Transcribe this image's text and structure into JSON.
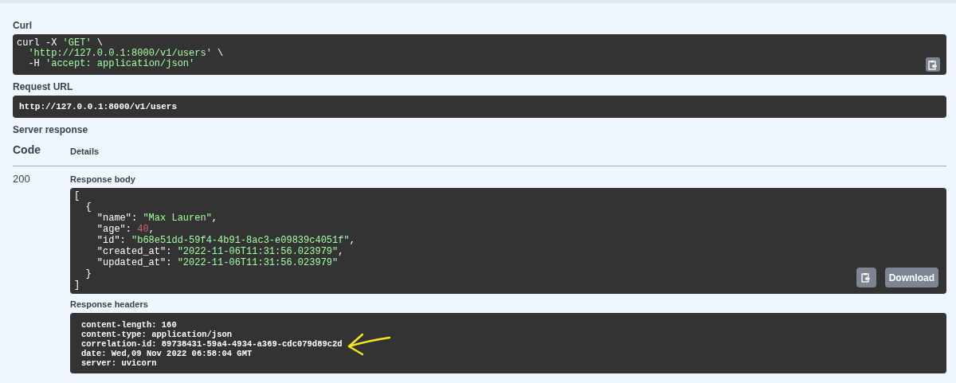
{
  "curl": {
    "label": "Curl",
    "lines": [
      [
        {
          "kind": "plain",
          "text": "curl -X "
        },
        {
          "kind": "string",
          "text": "'GET'"
        },
        {
          "kind": "plain",
          "text": " \\"
        }
      ],
      [
        {
          "kind": "string",
          "text": "  'http://127.0.0.1:8000/v1/users'"
        },
        {
          "kind": "plain",
          "text": " \\"
        }
      ],
      [
        {
          "kind": "plain",
          "text": "  -H "
        },
        {
          "kind": "string",
          "text": "'accept: application/json'"
        }
      ]
    ]
  },
  "request_url": {
    "label": "Request URL",
    "value": "http://127.0.0.1:8000/v1/users"
  },
  "server_response": {
    "label": "Server response",
    "columns": [
      "Code",
      "Details"
    ],
    "code": "200",
    "body": {
      "label": "Response body",
      "download": "Download",
      "lines": [
        [
          {
            "kind": "plain",
            "text": "["
          }
        ],
        [
          {
            "kind": "plain",
            "text": "  {"
          }
        ],
        [
          {
            "kind": "plain",
            "text": "    \"name\": "
          },
          {
            "kind": "string",
            "text": "\"Max Lauren\""
          },
          {
            "kind": "plain",
            "text": ","
          }
        ],
        [
          {
            "kind": "plain",
            "text": "    \"age\": "
          },
          {
            "kind": "number",
            "text": "40"
          },
          {
            "kind": "plain",
            "text": ","
          }
        ],
        [
          {
            "kind": "plain",
            "text": "    \"id\": "
          },
          {
            "kind": "string",
            "text": "\"b68e51dd-59f4-4b91-8ac3-e09839c4051f\""
          },
          {
            "kind": "plain",
            "text": ","
          }
        ],
        [
          {
            "kind": "plain",
            "text": "    \"created_at\": "
          },
          {
            "kind": "string",
            "text": "\"2022-11-06T11:31:56.023979\""
          },
          {
            "kind": "plain",
            "text": ","
          }
        ],
        [
          {
            "kind": "plain",
            "text": "    \"updated_at\": "
          },
          {
            "kind": "string",
            "text": "\"2022-11-06T11:31:56.023979\""
          }
        ],
        [
          {
            "kind": "plain",
            "text": "  }"
          }
        ],
        [
          {
            "kind": "plain",
            "text": "]"
          }
        ]
      ]
    },
    "headers": {
      "label": "Response headers",
      "lines": [
        "content-length: 160",
        "content-type: application/json",
        "correlation-id: 89738431-59a4-4934-a369-cdc079d89c2d",
        "date: Wed,09 Nov 2022 06:58:04 GMT",
        "server: uvicorn"
      ]
    }
  }
}
